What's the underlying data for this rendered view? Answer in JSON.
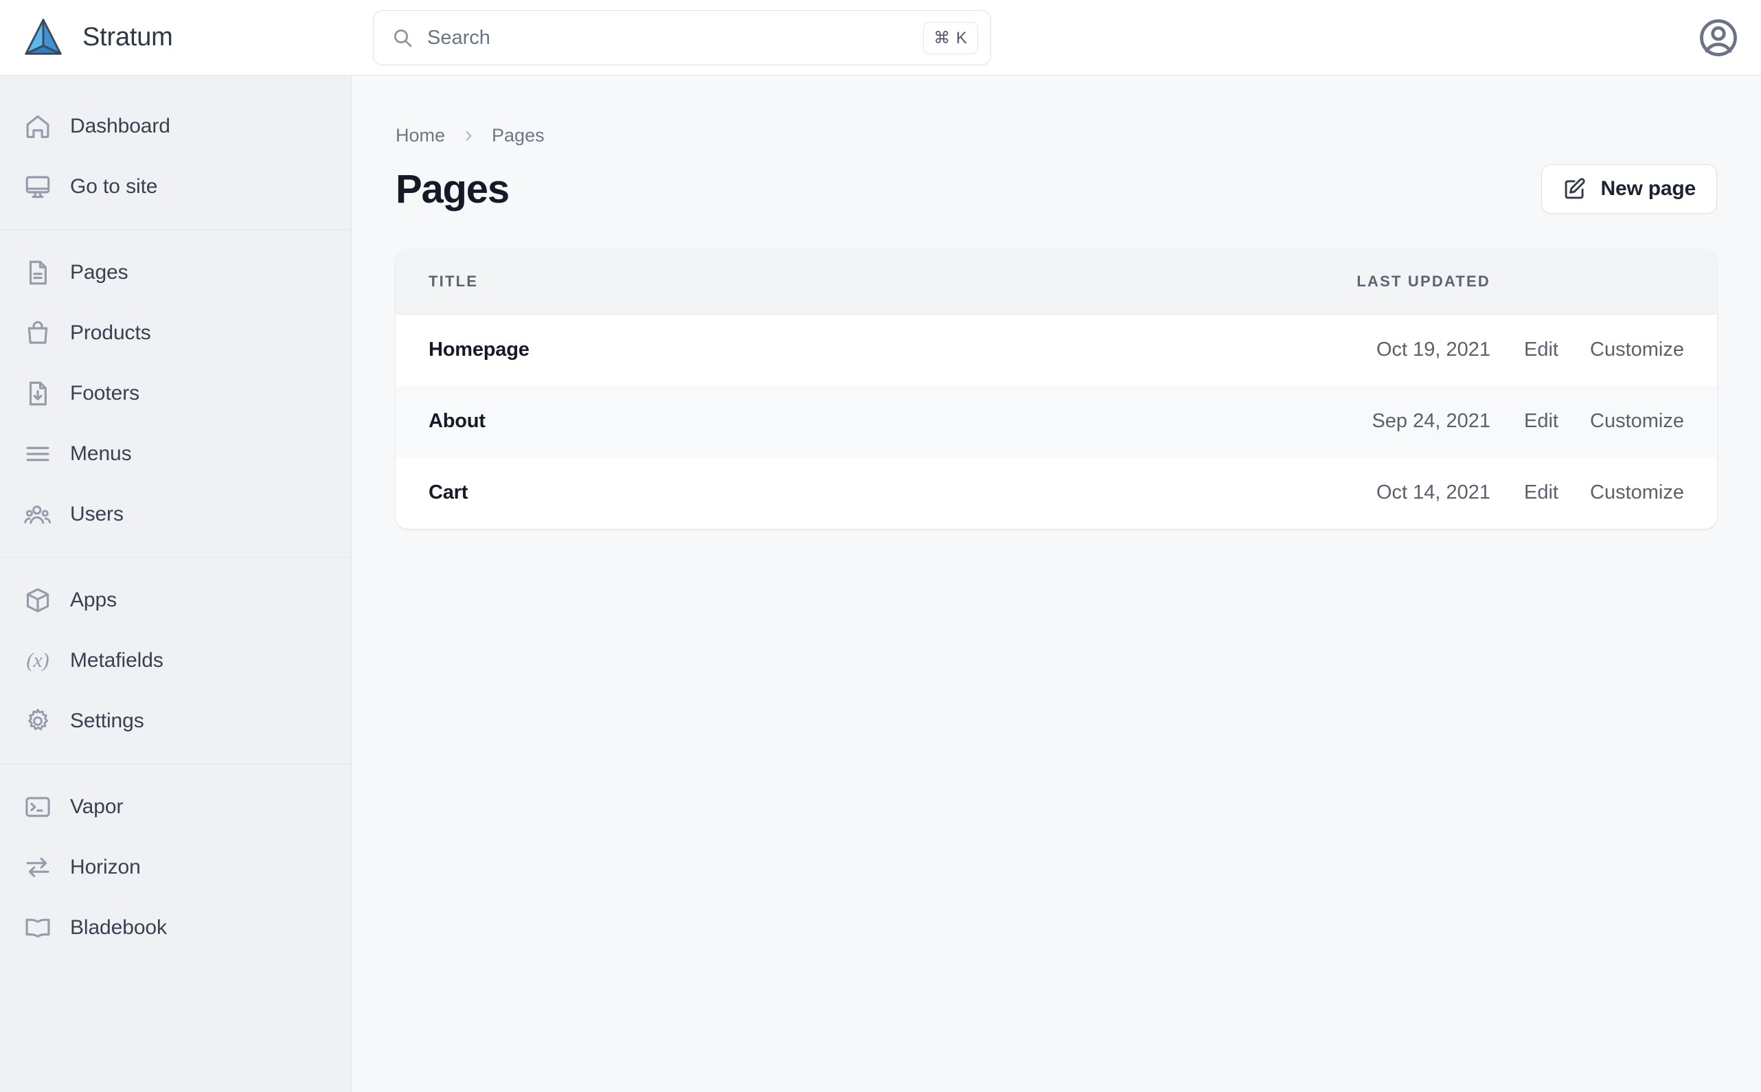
{
  "brand": {
    "name": "Stratum",
    "logo_icon": "triangle-pyramid-logo",
    "logo_colors": [
      "#5bb8ee",
      "#2f7ec4",
      "#3d4a5c"
    ]
  },
  "search": {
    "placeholder": "Search",
    "value": "",
    "shortcut": "⌘ K",
    "icon": "search-icon"
  },
  "account": {
    "icon": "account-circle-icon"
  },
  "sidebar": {
    "groups": [
      {
        "items": [
          {
            "label": "Dashboard",
            "icon": "home-icon"
          },
          {
            "label": "Go to site",
            "icon": "monitor-icon"
          }
        ]
      },
      {
        "items": [
          {
            "label": "Pages",
            "icon": "document-icon"
          },
          {
            "label": "Products",
            "icon": "shopping-bag-icon"
          },
          {
            "label": "Footers",
            "icon": "document-download-icon"
          },
          {
            "label": "Menus",
            "icon": "hamburger-lines-icon"
          },
          {
            "label": "Users",
            "icon": "users-group-icon"
          }
        ]
      },
      {
        "items": [
          {
            "label": "Apps",
            "icon": "cube-icon"
          },
          {
            "label": "Metafields",
            "icon": "variable-x-icon"
          },
          {
            "label": "Settings",
            "icon": "gear-icon"
          }
        ]
      },
      {
        "items": [
          {
            "label": "Vapor",
            "icon": "terminal-icon"
          },
          {
            "label": "Horizon",
            "icon": "arrows-exchange-icon"
          },
          {
            "label": "Bladebook",
            "icon": "open-book-icon"
          }
        ]
      }
    ]
  },
  "main": {
    "breadcrumb": {
      "home": "Home",
      "current": "Pages",
      "separator_icon": "chevron-right-icon"
    },
    "page_title": "Pages",
    "new_page_button": {
      "label": "New page",
      "icon": "edit-square-icon"
    },
    "table": {
      "headers": {
        "title": "TITLE",
        "last_updated": "LAST UPDATED"
      },
      "rows": [
        {
          "title": "Homepage",
          "last_updated": "Oct 19, 2021",
          "edit": "Edit",
          "customize": "Customize"
        },
        {
          "title": "About",
          "last_updated": "Sep 24, 2021",
          "edit": "Edit",
          "customize": "Customize"
        },
        {
          "title": "Cart",
          "last_updated": "Oct 14, 2021",
          "edit": "Edit",
          "customize": "Customize"
        }
      ]
    }
  }
}
